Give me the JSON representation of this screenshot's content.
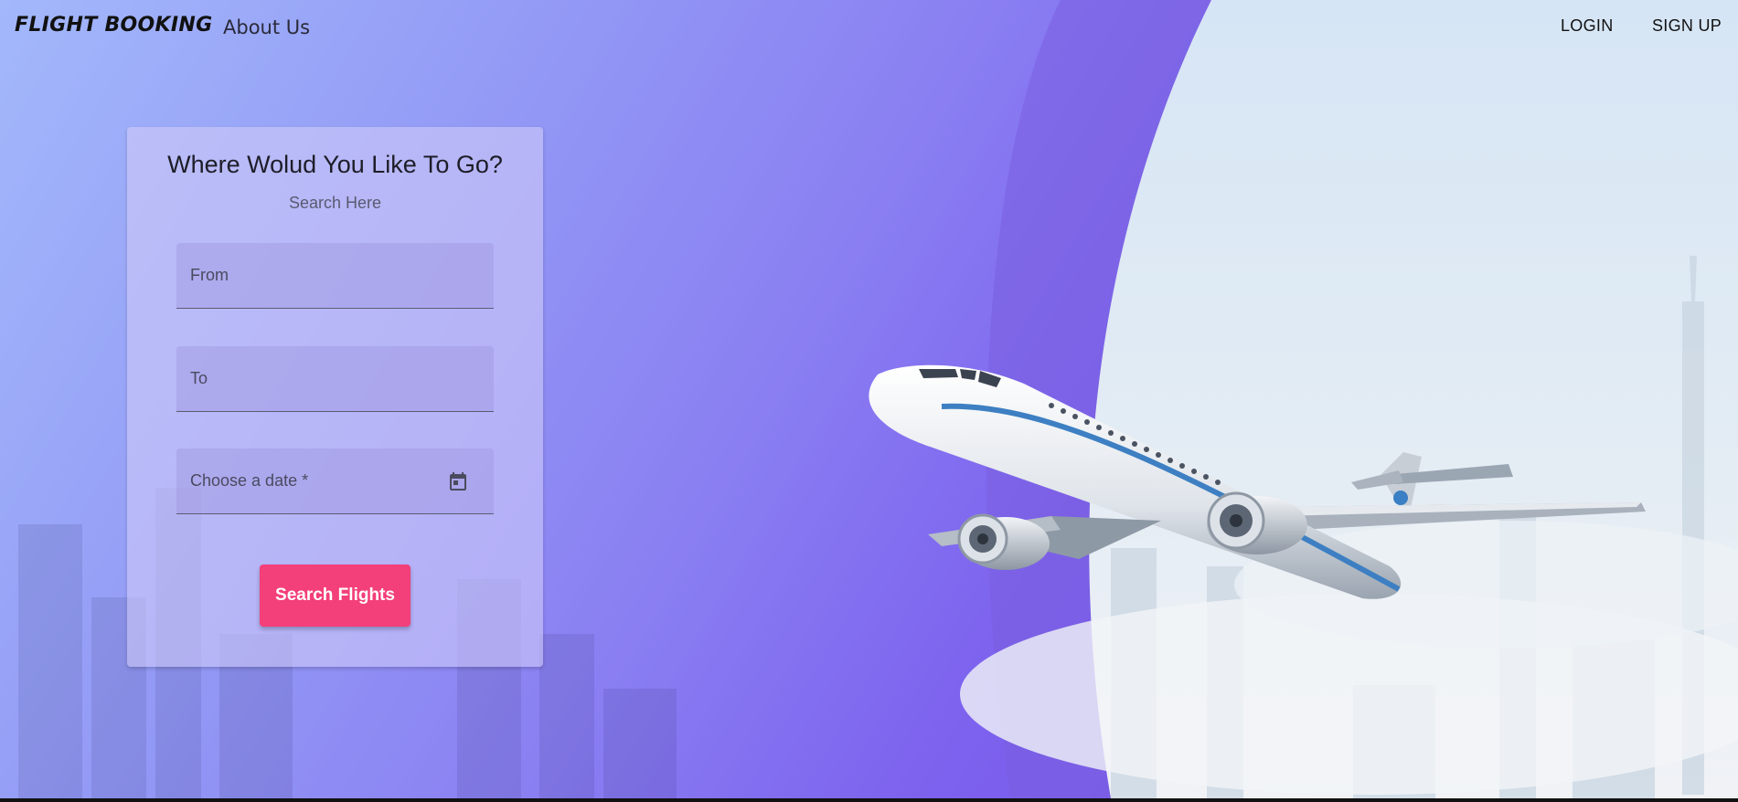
{
  "header": {
    "brand": "FLIGHT BOOKING",
    "about": "About Us",
    "login": "LOGIN",
    "signup": "SIGN UP"
  },
  "search_card": {
    "title": "Where Wolud You Like To Go?",
    "subtitle": "Search Here",
    "from_placeholder": "From",
    "to_placeholder": "To",
    "date_placeholder": "Choose a date *",
    "date_icon": "calendar-icon",
    "button_label": "Search Flights"
  },
  "colors": {
    "button": "#f33f7a",
    "gradient_start": "#a3b8fb",
    "gradient_end": "#7655ea",
    "sky": "#dbe8f6"
  }
}
